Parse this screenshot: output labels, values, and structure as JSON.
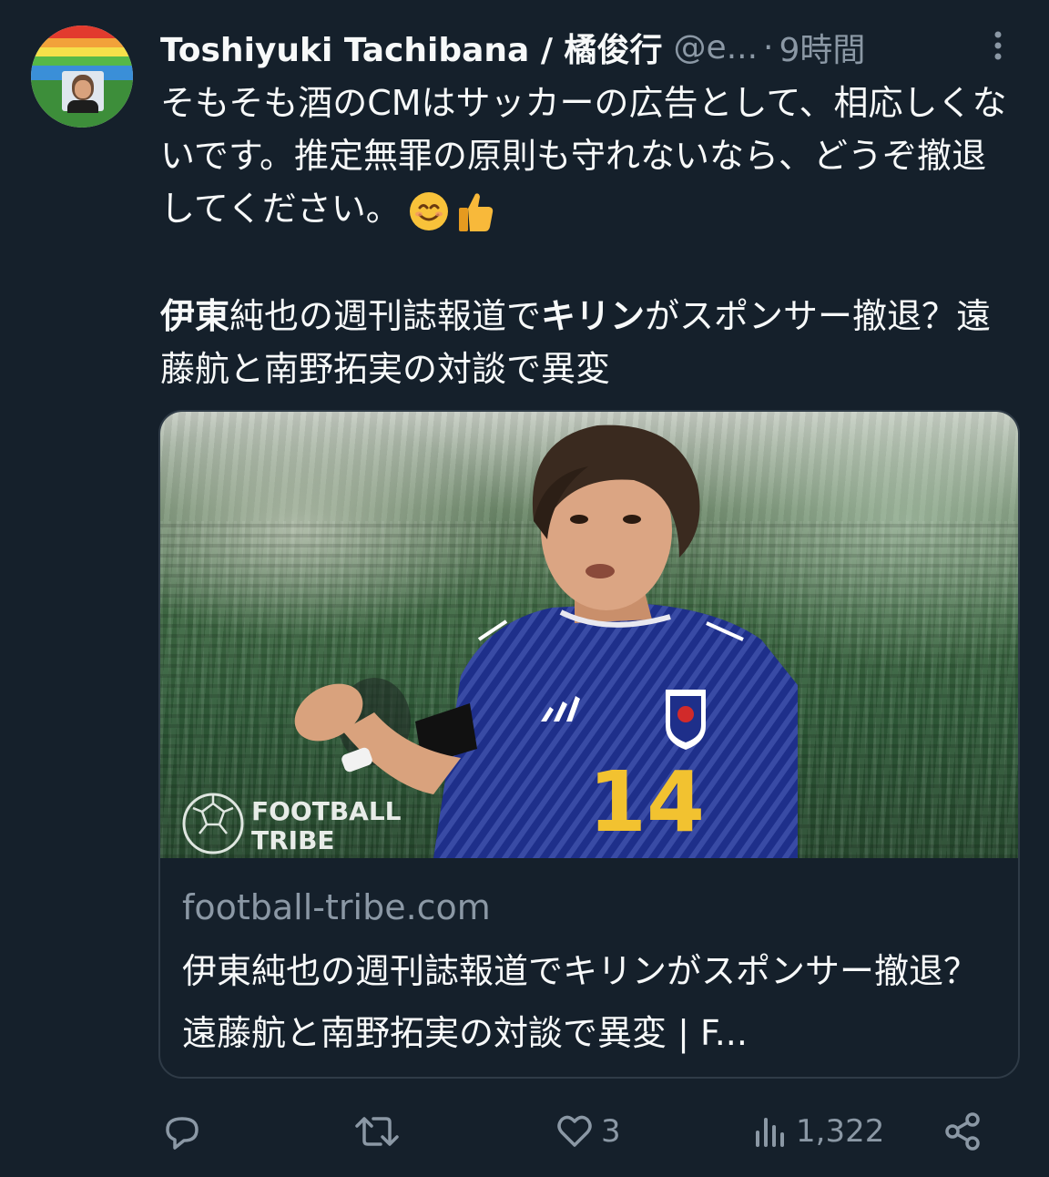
{
  "author": {
    "name": "Toshiyuki Tachibana / 橘俊行",
    "handle": "@e...",
    "separator": "·",
    "time": "9時間"
  },
  "tweet": {
    "text": "そもそも酒のCMはサッカーの広告として、相応しくないです。推定無罪の原則も守れないなら、どうぞ撤退してください。",
    "emojis": [
      "smiling-face-emoji",
      "thumbs-up-emoji"
    ]
  },
  "quoted_headline": {
    "part1_bold": "伊東",
    "part2": "純也の週刊誌報道で",
    "part3_bold": "キリン",
    "part4": "がスポンサー撤退？遠藤航と南野拓実の対談で異変"
  },
  "link_card": {
    "image_logo_line1": "FOOTBALL",
    "image_logo_line2": "TRIBE",
    "jersey_number": "14",
    "domain": "football-tribe.com",
    "title": "伊東純也の週刊誌報道でキリンがスポンサー撤退？遠藤航と南野拓実の対談で異変 | F..."
  },
  "actions": {
    "reply_count": "",
    "retweet_count": "",
    "like_count": "3",
    "views_count": "1,322"
  },
  "colors": {
    "background": "#15202b",
    "primary_text": "#f7f9f9",
    "secondary_text": "#8b98a5",
    "border": "#2f3b47",
    "jersey_blue": "#1e2f8a",
    "jersey_number": "#f2c230"
  }
}
